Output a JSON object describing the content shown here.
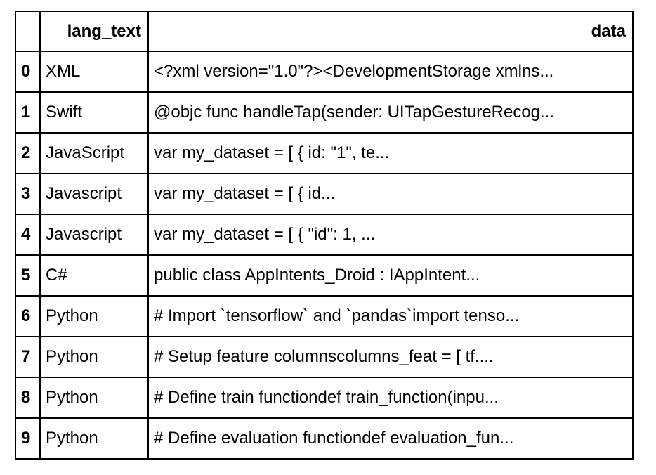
{
  "table": {
    "columns": [
      {
        "key": "index",
        "label": ""
      },
      {
        "key": "lang_text",
        "label": "lang_text"
      },
      {
        "key": "data",
        "label": "data"
      }
    ],
    "rows": [
      {
        "index": "0",
        "lang_text": "XML",
        "data": "<?xml version=\"1.0\"?><DevelopmentStorage xmlns..."
      },
      {
        "index": "1",
        "lang_text": "Swift",
        "data": "@objc func handleTap(sender: UITapGestureRecog..."
      },
      {
        "index": "2",
        "lang_text": "JavaScript",
        "data": "var my_dataset = [ { id: \"1\", te..."
      },
      {
        "index": "3",
        "lang_text": "Javascript",
        "data": "var my_dataset = [ { id..."
      },
      {
        "index": "4",
        "lang_text": "Javascript",
        "data": "var my_dataset = [ { \"id\": 1, ..."
      },
      {
        "index": "5",
        "lang_text": "C#",
        "data": "public class AppIntents_Droid : IAppIntent..."
      },
      {
        "index": "6",
        "lang_text": "Python",
        "data": "# Import `tensorflow` and `pandas`import tenso..."
      },
      {
        "index": "7",
        "lang_text": "Python",
        "data": "# Setup feature columnscolumns_feat = [ tf...."
      },
      {
        "index": "8",
        "lang_text": "Python",
        "data": "# Define train functiondef train_function(inpu..."
      },
      {
        "index": "9",
        "lang_text": "Python",
        "data": "# Define evaluation functiondef evaluation_fun..."
      }
    ]
  },
  "style": {
    "border_color": "#000000",
    "background_color": "#ffffff",
    "text_color": "#000000"
  }
}
